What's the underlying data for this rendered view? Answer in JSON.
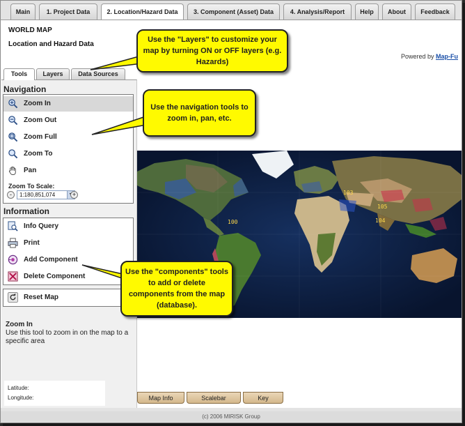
{
  "tabs": [
    {
      "label": "Main",
      "active": false
    },
    {
      "label": "1. Project Data",
      "active": false
    },
    {
      "label": "2. Location/Hazard Data",
      "active": true
    },
    {
      "label": "3. Component (Asset) Data",
      "active": false
    },
    {
      "label": "4. Analysis/Report",
      "active": false
    },
    {
      "label": "Help",
      "active": false
    },
    {
      "label": "About",
      "active": false
    },
    {
      "label": "Feedback",
      "active": false
    }
  ],
  "page": {
    "title": "WORLD MAP",
    "subtitle": "Location and Hazard Data",
    "powered_by": "Powered by",
    "powered_link": "Map-Fu"
  },
  "left_tabs": [
    {
      "label": "Tools",
      "active": true
    },
    {
      "label": "Layers",
      "active": false
    },
    {
      "label": "Data Sources",
      "active": false
    }
  ],
  "navigation": {
    "heading": "Navigation",
    "items": [
      {
        "label": "Zoom In",
        "icon": "zoom-in-icon",
        "selected": true
      },
      {
        "label": "Zoom Out",
        "icon": "zoom-out-icon",
        "selected": false
      },
      {
        "label": "Zoom Full",
        "icon": "zoom-full-icon",
        "selected": false
      },
      {
        "label": "Zoom To",
        "icon": "zoom-to-icon",
        "selected": false
      },
      {
        "label": "Pan",
        "icon": "hand-icon",
        "selected": false
      }
    ],
    "zoom_to_scale_label": "Zoom To Scale:",
    "scale_value": "1:180,851,074",
    "minus": "-",
    "plus": "+"
  },
  "information": {
    "heading": "Information",
    "items": [
      {
        "label": "Info Query",
        "icon": "info-query-icon"
      },
      {
        "label": "Print",
        "icon": "printer-icon"
      },
      {
        "label": "Add Component",
        "icon": "add-component-icon"
      },
      {
        "label": "Delete Component",
        "icon": "delete-component-icon"
      }
    ],
    "reset_label": "Reset Map",
    "reset_icon": "reset-icon"
  },
  "help": {
    "title": "Zoom In",
    "text": "Use this tool to zoom in on the map to a specific area"
  },
  "coords": {
    "latitude_label": "Latitude:",
    "longitude_label": "Longitude:"
  },
  "map": {
    "labels": [
      "100",
      "103",
      "105",
      "104"
    ]
  },
  "bottom_tabs": [
    "Map Info",
    "Scalebar",
    "Key"
  ],
  "footer": "(c) 2006 MIRISK Group",
  "callouts": {
    "layers": "Use the \"Layers\" to customize your map by turning ON or OFF layers (e.g. Hazards)",
    "navigation": "Use the navigation tools to zoom in, pan, etc.",
    "components": "Use the \"components\" tools to add or delete components from the map (database)."
  },
  "colors": {
    "callout_fill": "#fffa00",
    "accent_link": "#1a4fa8",
    "bottom_tab": "#d4b88c"
  }
}
